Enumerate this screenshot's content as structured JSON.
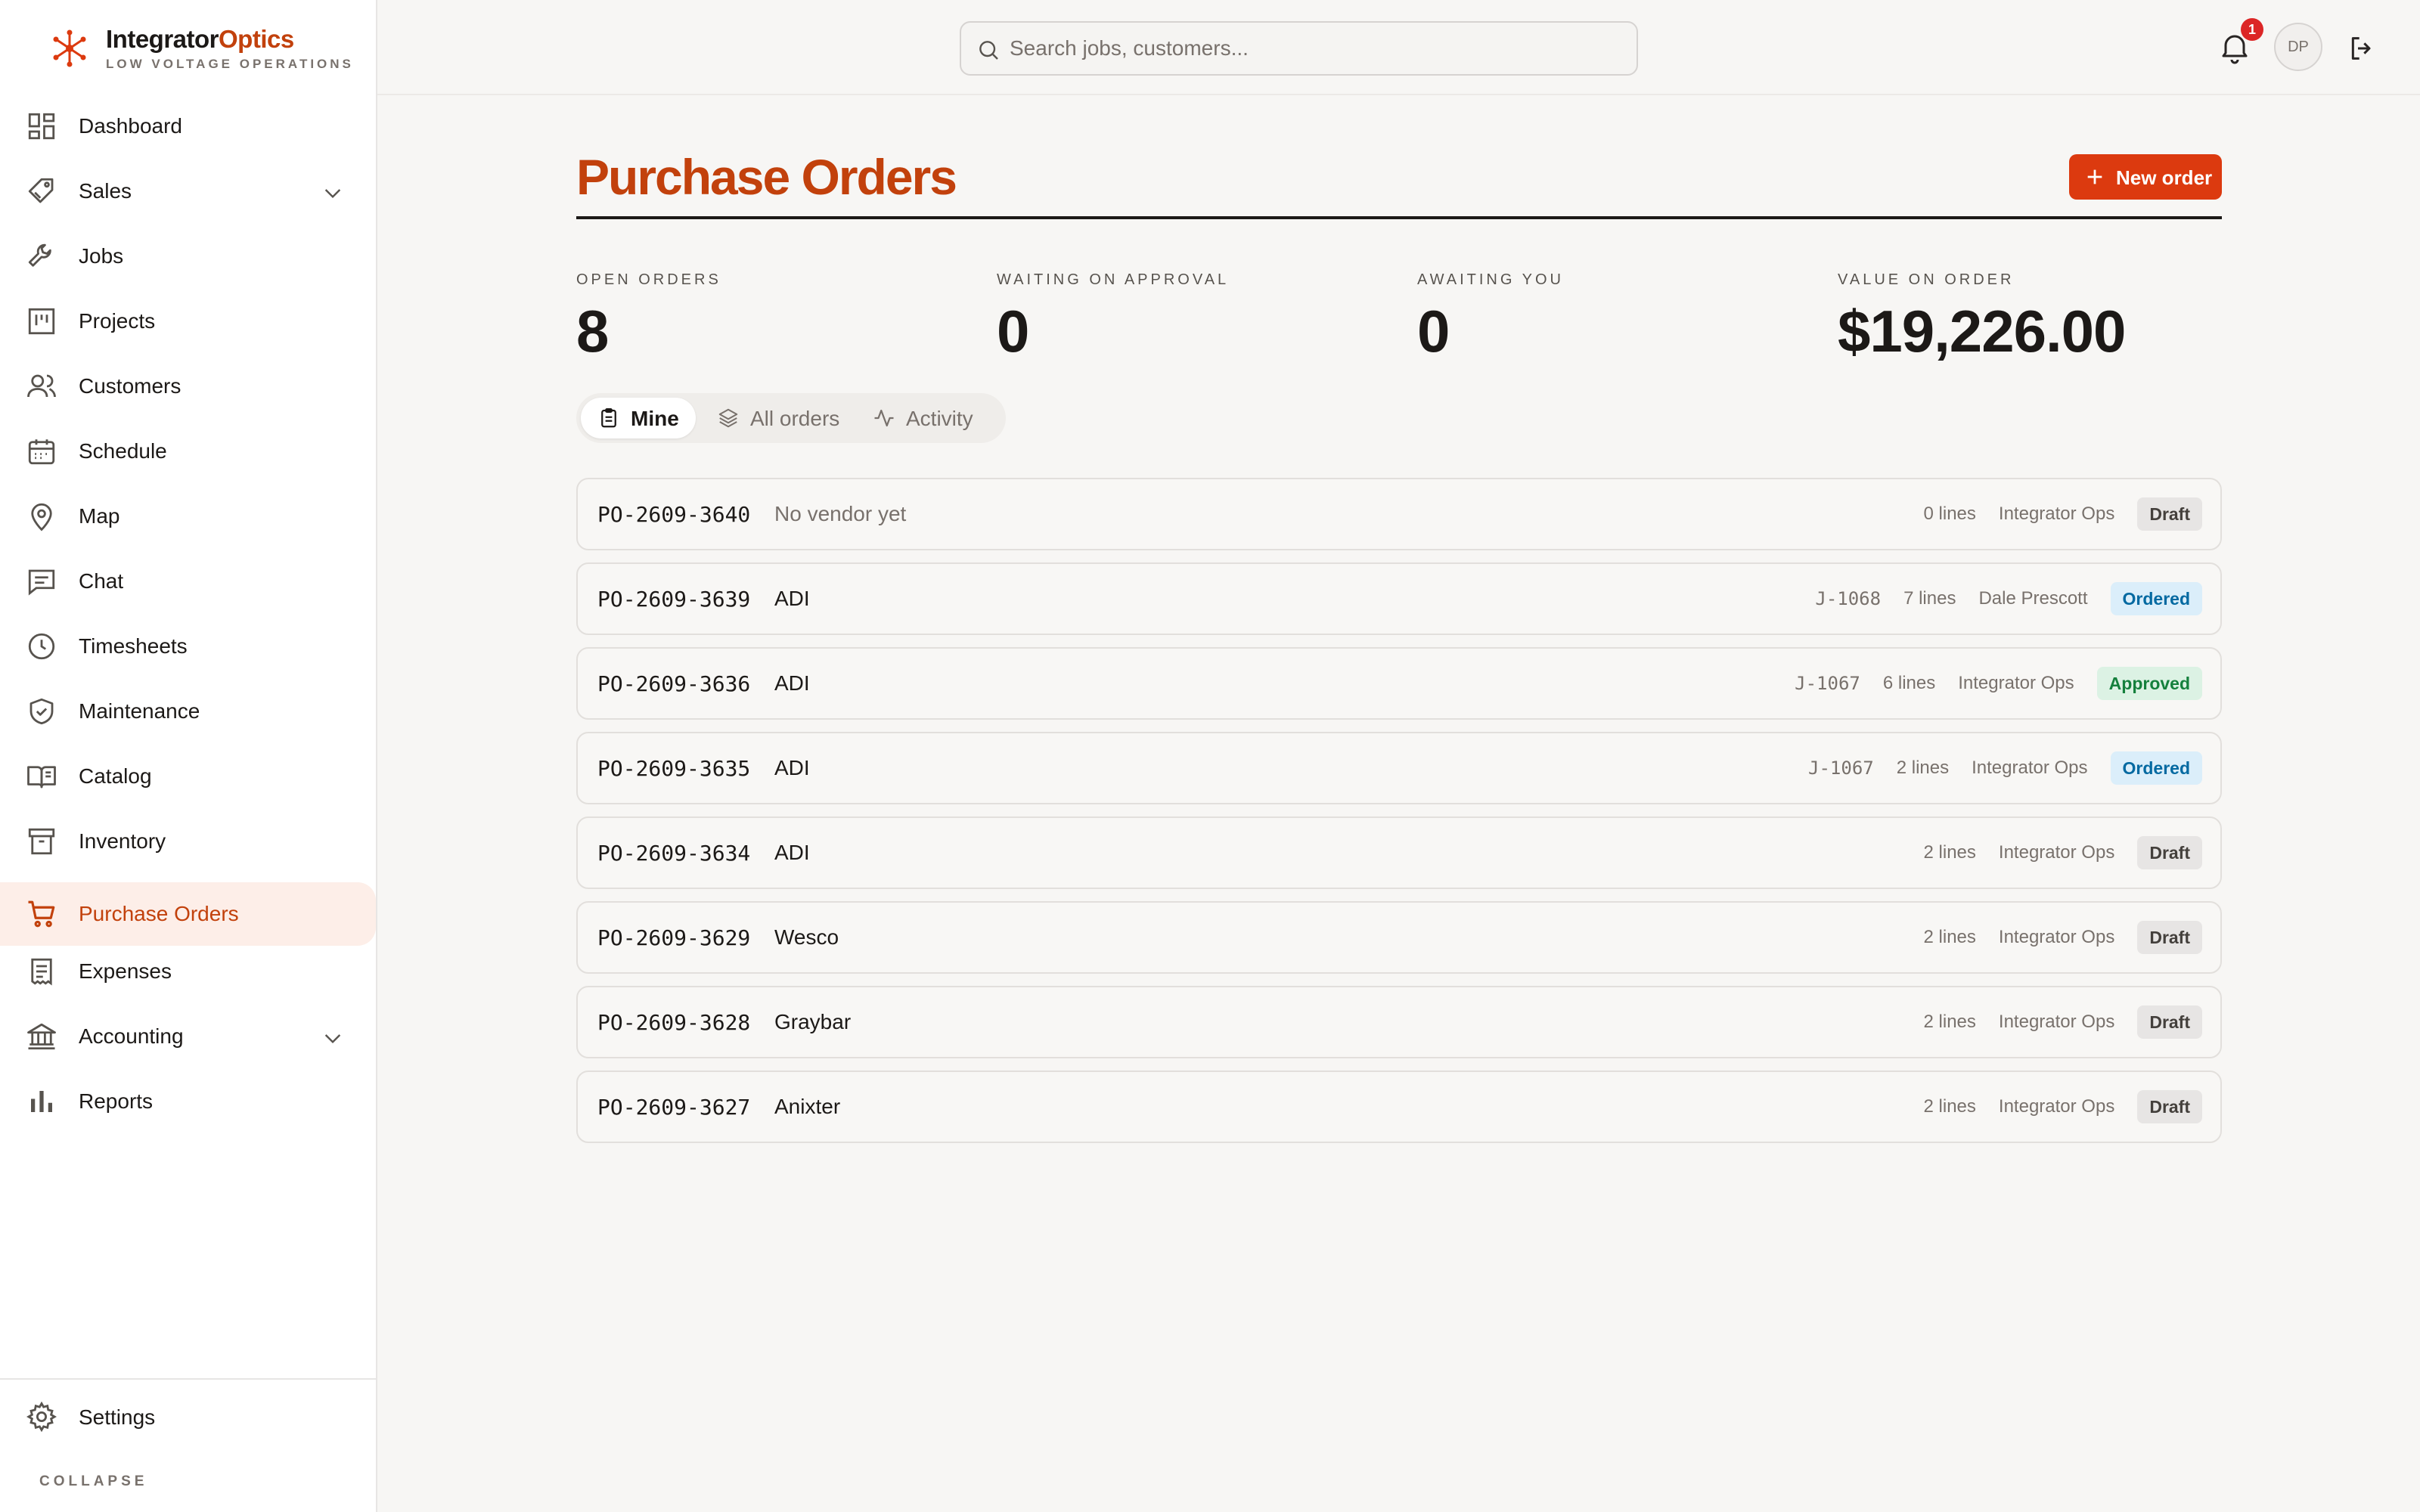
{
  "brand": {
    "name_main": "Integrator",
    "name_accent": "Optics",
    "tagline": "LOW VOLTAGE OPERATIONS"
  },
  "sidebar": {
    "items": [
      {
        "label": "Dashboard",
        "icon": "dashboard-icon"
      },
      {
        "label": "Sales",
        "icon": "tag-icon",
        "expandable": true
      },
      {
        "label": "Jobs",
        "icon": "wrench-icon"
      },
      {
        "label": "Projects",
        "icon": "kanban-icon"
      },
      {
        "label": "Customers",
        "icon": "users-icon"
      },
      {
        "label": "Schedule",
        "icon": "calendar-icon"
      },
      {
        "label": "Map",
        "icon": "map-pin-icon"
      },
      {
        "label": "Chat",
        "icon": "chat-icon"
      },
      {
        "label": "Timesheets",
        "icon": "clock-icon"
      },
      {
        "label": "Maintenance",
        "icon": "shield-check-icon"
      },
      {
        "label": "Catalog",
        "icon": "book-icon"
      },
      {
        "label": "Inventory",
        "icon": "archive-icon"
      },
      {
        "label": "Purchase Orders",
        "icon": "cart-icon",
        "active": true
      },
      {
        "label": "Expenses",
        "icon": "receipt-icon"
      },
      {
        "label": "Accounting",
        "icon": "bank-icon",
        "expandable": true
      },
      {
        "label": "Reports",
        "icon": "bar-chart-icon"
      }
    ],
    "settings_label": "Settings",
    "collapse_label": "COLLAPSE"
  },
  "topbar": {
    "search_placeholder": "Search jobs, customers...",
    "notification_count": "1",
    "avatar_initials": "DP"
  },
  "page": {
    "title": "Purchase Orders",
    "new_order_label": "New order"
  },
  "stats": [
    {
      "label": "OPEN ORDERS",
      "value": "8"
    },
    {
      "label": "WAITING ON APPROVAL",
      "value": "0"
    },
    {
      "label": "AWAITING YOU",
      "value": "0"
    },
    {
      "label": "VALUE ON ORDER",
      "value": "$19,226.00"
    }
  ],
  "tabs": [
    {
      "label": "Mine",
      "icon": "clipboard-icon",
      "active": true
    },
    {
      "label": "All orders",
      "icon": "layers-icon"
    },
    {
      "label": "Activity",
      "icon": "activity-icon"
    }
  ],
  "orders": [
    {
      "po": "PO-2609-3640",
      "vendor": "No vendor yet",
      "vendor_empty": true,
      "job": "",
      "lines": "0 lines",
      "owner": "Integrator Ops",
      "status": "Draft",
      "status_kind": "draft"
    },
    {
      "po": "PO-2609-3639",
      "vendor": "ADI",
      "job": "J-1068",
      "lines": "7 lines",
      "owner": "Dale Prescott",
      "status": "Ordered",
      "status_kind": "ordered"
    },
    {
      "po": "PO-2609-3636",
      "vendor": "ADI",
      "job": "J-1067",
      "lines": "6 lines",
      "owner": "Integrator Ops",
      "status": "Approved",
      "status_kind": "approved"
    },
    {
      "po": "PO-2609-3635",
      "vendor": "ADI",
      "job": "J-1067",
      "lines": "2 lines",
      "owner": "Integrator Ops",
      "status": "Ordered",
      "status_kind": "ordered"
    },
    {
      "po": "PO-2609-3634",
      "vendor": "ADI",
      "job": "",
      "lines": "2 lines",
      "owner": "Integrator Ops",
      "status": "Draft",
      "status_kind": "draft"
    },
    {
      "po": "PO-2609-3629",
      "vendor": "Wesco",
      "job": "",
      "lines": "2 lines",
      "owner": "Integrator Ops",
      "status": "Draft",
      "status_kind": "draft"
    },
    {
      "po": "PO-2609-3628",
      "vendor": "Graybar",
      "job": "",
      "lines": "2 lines",
      "owner": "Integrator Ops",
      "status": "Draft",
      "status_kind": "draft"
    },
    {
      "po": "PO-2609-3627",
      "vendor": "Anixter",
      "job": "",
      "lines": "2 lines",
      "owner": "Integrator Ops",
      "status": "Draft",
      "status_kind": "draft"
    }
  ],
  "colors": {
    "accent": "#c2410c",
    "button": "#dc3a0f",
    "active_nav_bg": "#fdeee8",
    "draft_bg": "#e7e5e4",
    "ordered_bg": "#dbeefa",
    "approved_bg": "#dcf2e4"
  }
}
